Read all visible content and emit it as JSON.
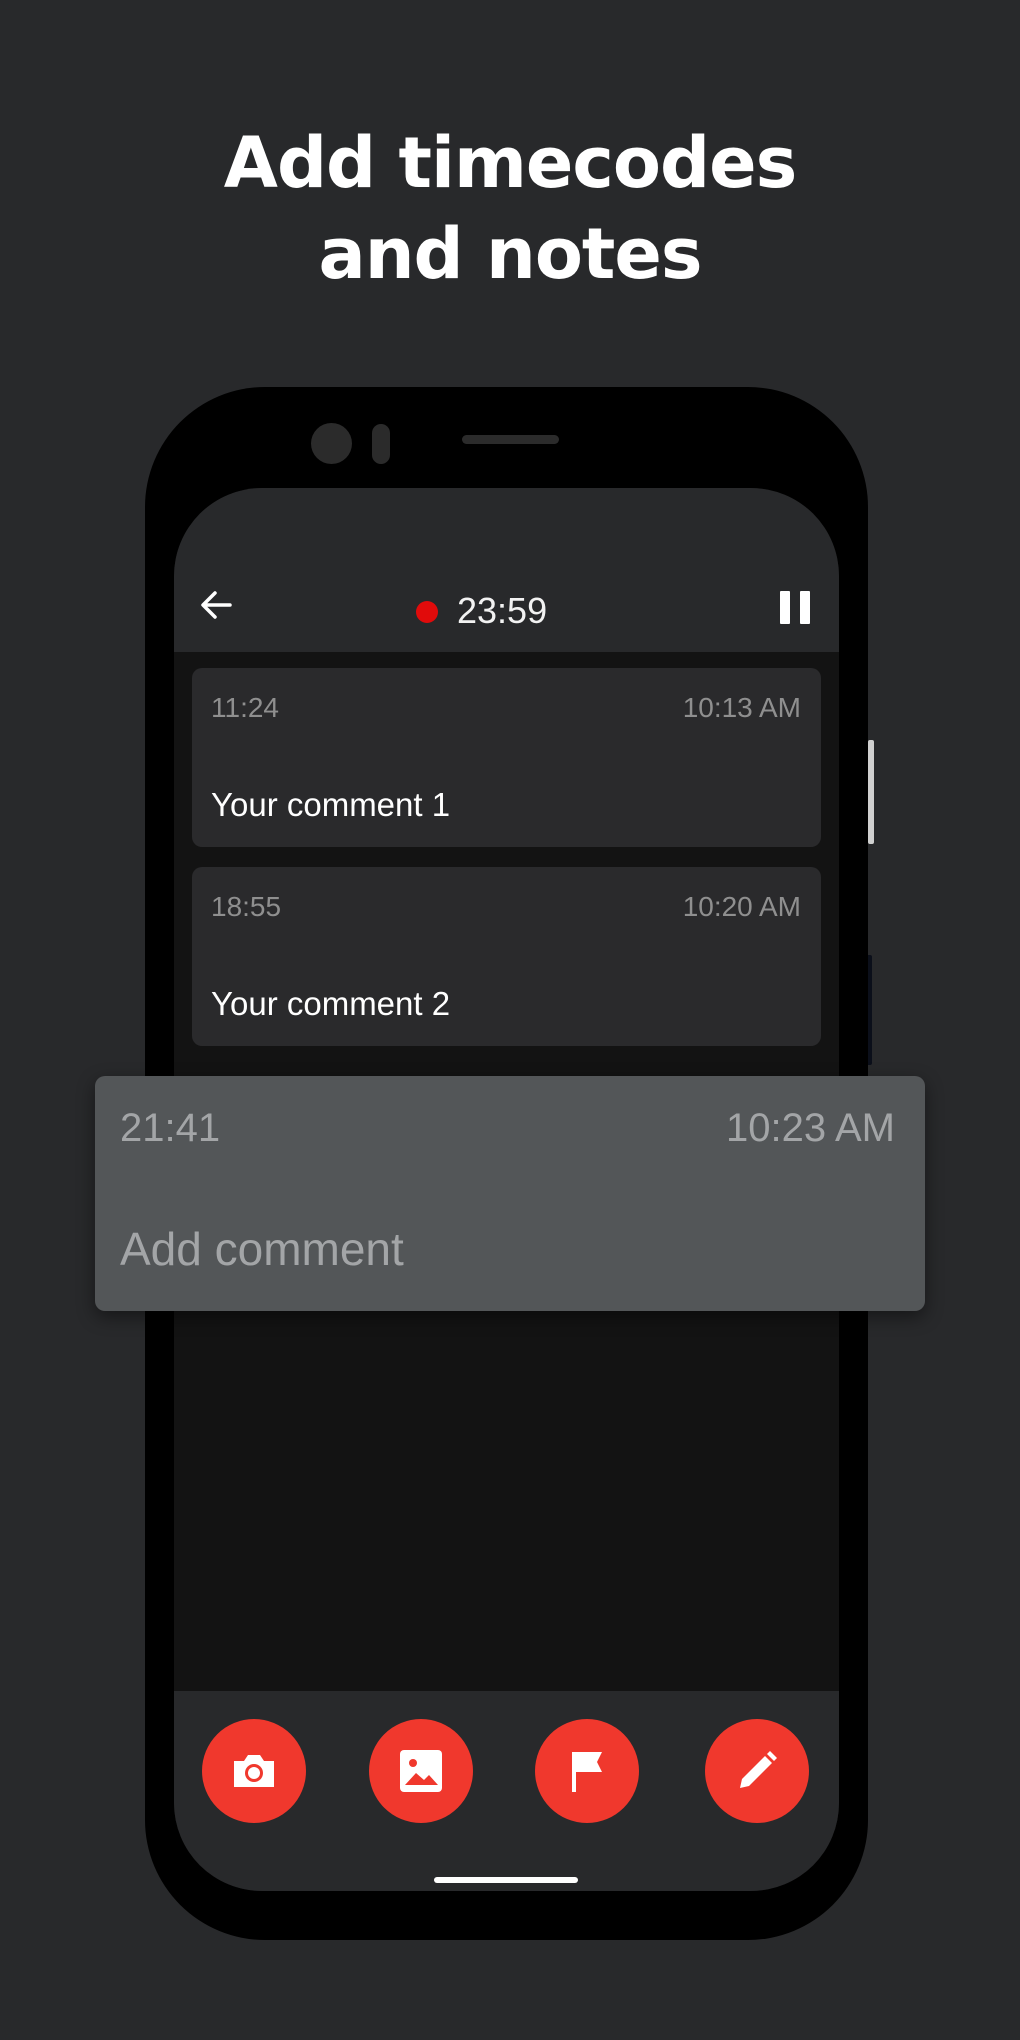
{
  "headline": {
    "line1": "Add timecodes",
    "line2": "and notes"
  },
  "appbar": {
    "timer": "23:59"
  },
  "notes": [
    {
      "timecode": "11:24",
      "time": "10:13 AM",
      "comment": "Your comment 1"
    },
    {
      "timecode": "18:55",
      "time": "10:20 AM",
      "comment": "Your comment 2"
    }
  ],
  "new_note": {
    "timecode": "21:41",
    "time": "10:23 AM",
    "placeholder": "Add comment"
  },
  "toolbar": {
    "buttons": [
      {
        "icon": "camera-icon"
      },
      {
        "icon": "image-icon"
      },
      {
        "icon": "flag-icon"
      },
      {
        "icon": "pencil-icon"
      }
    ]
  },
  "colors": {
    "background": "#28292b",
    "accent": "#f0382d",
    "record": "#e10b0b",
    "popup": "#535658"
  }
}
